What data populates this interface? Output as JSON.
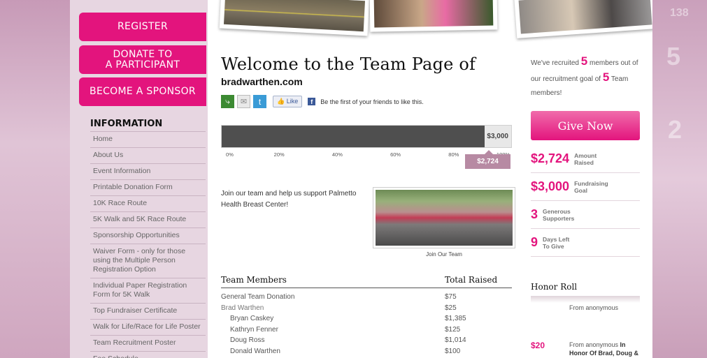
{
  "sidebar": {
    "register_label": "REGISTER",
    "donate_label_1": "DONATE TO",
    "donate_label_2": "A PARTICIPANT",
    "sponsor_label": "BECOME A SPONSOR",
    "info_title": "INFORMATION",
    "items": [
      "Home",
      "About Us",
      "Event Information",
      "Printable Donation Form",
      "10K Race Route",
      "5K Walk and 5K Race Route",
      "Sponsorship Opportunities",
      "Waiver Form - only for those using the Multiple Person Registration Option",
      "Individual Paper Registration Form for 5K Walk",
      "Top Fundraiser Certificate",
      "Walk for Life/Race for Life Poster",
      "Team Recruitment Poster",
      "Fee Schedule"
    ]
  },
  "header": {
    "title": "Welcome to the Team Page of",
    "subtitle": "bradwarthen.com"
  },
  "social": {
    "like_label": "Like",
    "like_text": "Be the first of your friends to like this."
  },
  "thermometer": {
    "goal_label": "$3,000",
    "raised_label": "$2,724",
    "fraction": 0.908,
    "ticks": [
      "0%",
      "20%",
      "40%",
      "60%",
      "80%",
      "100%"
    ]
  },
  "intro": {
    "text": "Join our team and help us support Palmetto Health Breast Center!",
    "photo_caption": "Join Our Team"
  },
  "members": {
    "col_name": "Team Members",
    "col_total": "Total Raised",
    "rows": [
      {
        "name": "General Team Donation",
        "amount": "$75"
      },
      {
        "name": "Brad Warthen",
        "amount": "$25"
      },
      {
        "name": "Bryan Caskey",
        "amount": "$1,385"
      },
      {
        "name": "Kathryn Fenner",
        "amount": "$125"
      },
      {
        "name": "Doug Ross",
        "amount": "$1,014"
      },
      {
        "name": "Donald Warthen",
        "amount": "$100"
      }
    ]
  },
  "recruit": {
    "prefix": "We've recruited",
    "count": "5",
    "mid": "members out of our recruitment goal of",
    "goal": "5",
    "suffix": "Team members!"
  },
  "give_now_label": "Give Now",
  "stats": [
    {
      "value": "$2,724",
      "l1": "Amount",
      "l2": "Raised"
    },
    {
      "value": "$3,000",
      "l1": "Fundraising",
      "l2": "Goal"
    },
    {
      "value": "3",
      "l1": "Generous",
      "l2": "Supporters"
    },
    {
      "value": "9",
      "l1": "Days Left",
      "l2": "To Give"
    }
  ],
  "honor": {
    "title": "Honor Roll",
    "entry1": "From anonymous",
    "entry2_amount": "$20",
    "entry2_from": "From anonymous",
    "entry2_bold": "In Honor Of Brad, Doug & ..."
  },
  "colors": {
    "accent": "#e3147d",
    "thermometer_fill": "#4f4f4f",
    "raised_tag": "#b78aa3"
  },
  "bg_numbers": [
    "138",
    "5",
    "2"
  ]
}
